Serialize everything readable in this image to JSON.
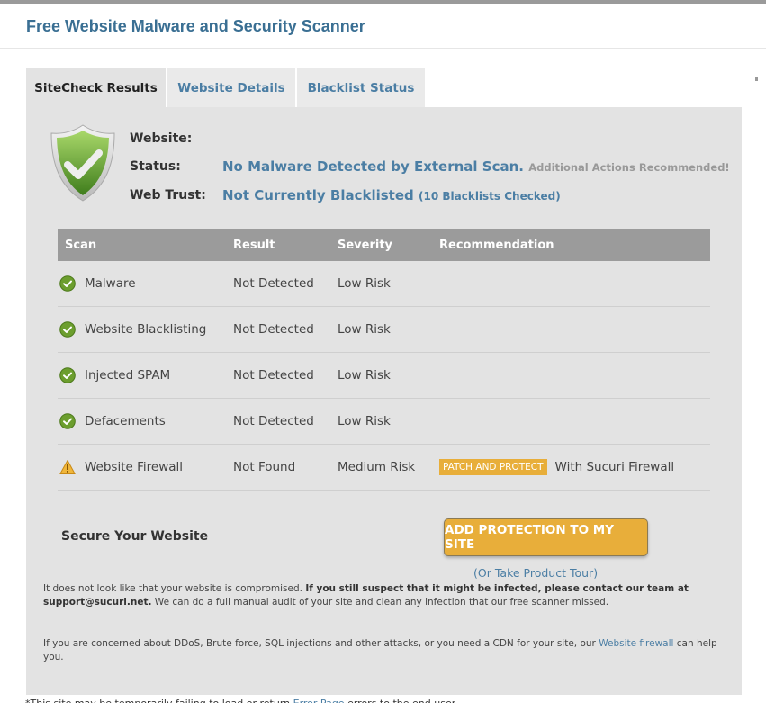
{
  "page": {
    "title": "Free Website Malware and Security Scanner"
  },
  "tabs": [
    {
      "label": "SiteCheck Results",
      "active": true
    },
    {
      "label": "Website Details",
      "active": false
    },
    {
      "label": "Blacklist Status",
      "active": false
    }
  ],
  "summary": {
    "website_label": "Website:",
    "website_value": "",
    "status_label": "Status:",
    "status_value": "No Malware Detected by External Scan.",
    "status_note": "Additional Actions Recommended!",
    "trust_label": "Web Trust:",
    "trust_value": "Not Currently Blacklisted",
    "trust_note": "(10 Blacklists Checked)"
  },
  "table": {
    "headers": [
      "Scan",
      "Result",
      "Severity",
      "Recommendation"
    ],
    "rows": [
      {
        "icon": "check-circle-icon",
        "scan": "Malware",
        "result": "Not Detected",
        "severity": "Low Risk",
        "badge": "",
        "recommendation": ""
      },
      {
        "icon": "check-circle-icon",
        "scan": "Website Blacklisting",
        "result": "Not Detected",
        "severity": "Low Risk",
        "badge": "",
        "recommendation": ""
      },
      {
        "icon": "check-circle-icon",
        "scan": "Injected SPAM",
        "result": "Not Detected",
        "severity": "Low Risk",
        "badge": "",
        "recommendation": ""
      },
      {
        "icon": "check-circle-icon",
        "scan": "Defacements",
        "result": "Not Detected",
        "severity": "Low Risk",
        "badge": "",
        "recommendation": ""
      },
      {
        "icon": "warning-triangle-icon",
        "scan": "Website Firewall",
        "result": "Not Found",
        "severity": "Medium Risk",
        "badge": "PATCH AND PROTECT",
        "recommendation": "With Sucuri Firewall"
      }
    ]
  },
  "secure": {
    "label": "Secure Your Website",
    "cta_label": "ADD PROTECTION TO MY SITE",
    "tour_open": "(",
    "tour_link": "Or Take Product Tour",
    "tour_close": ")"
  },
  "notes": {
    "note1_a": "It does not look like that your website is compromised. ",
    "note1_b": "If you still suspect that it might be infected, please contact our team at support@sucuri.net.",
    "note1_c": " We can do a full manual audit of your site and clean any infection that our free scanner missed.",
    "note2_a": "If you are concerned about DDoS, Brute force, SQL injections and other attacks, or you need a CDN for your site, our ",
    "note2_link": "Website firewall",
    "note2_b": " can help you."
  },
  "footer": {
    "text_a": "*This site may be temporarily failing to load or return ",
    "link": "Error Page",
    "text_b": " errors to the end user"
  },
  "colors": {
    "accent_blue": "#4b7ea4",
    "title_blue": "#3a6f93",
    "cta_orange": "#e8ae3a",
    "header_gray": "#9b9b9b",
    "panel_bg": "#e3e3e3"
  }
}
